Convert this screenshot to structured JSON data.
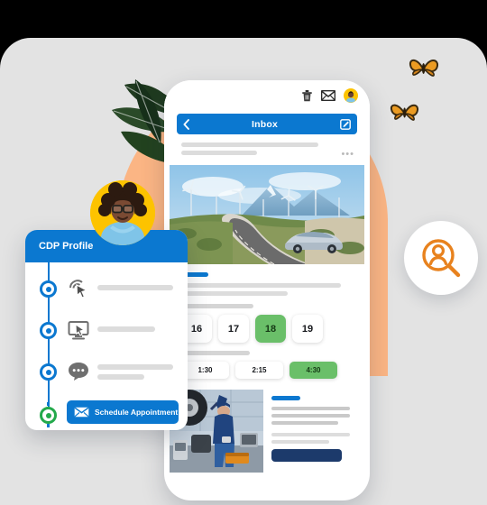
{
  "colors": {
    "brand_blue": "#0b78d0",
    "navy": "#1c3a6b",
    "green": "#6abf69",
    "green_dot": "#23a94b",
    "peach": "#fbb584",
    "yellow": "#fdc300",
    "orange": "#e8821e",
    "canvas_gray": "#e3e3e3"
  },
  "phone": {
    "top_icons": [
      "trash-icon",
      "envelope-icon",
      "avatar-icon"
    ],
    "navbar": {
      "back_icon": "chevron-left-icon",
      "title": "Inbox",
      "compose_icon": "compose-icon"
    },
    "message": {
      "overflow": "•••"
    },
    "hero_image": "highway-with-wind-turbines-and-silver-car",
    "appointment": {
      "days": [
        {
          "label": "16",
          "selected": false
        },
        {
          "label": "17",
          "selected": false
        },
        {
          "label": "18",
          "selected": true
        },
        {
          "label": "19",
          "selected": false
        }
      ],
      "times": [
        {
          "label": "1:30",
          "selected": false
        },
        {
          "label": "2:15",
          "selected": false
        },
        {
          "label": "4:30",
          "selected": true
        }
      ]
    },
    "bottom_card": {
      "thumb": "mechanic-servicing-car-in-garage"
    }
  },
  "cdp_card": {
    "title": "CDP Profile",
    "steps": [
      {
        "icon": "click-target-icon",
        "completed": true
      },
      {
        "icon": "desktop-click-icon",
        "completed": true
      },
      {
        "icon": "chat-bubble-icon",
        "completed": true
      },
      {
        "icon": "envelope-icon",
        "completed": true
      }
    ],
    "cta": {
      "icon": "envelope-icon",
      "label": "Schedule Appointment"
    }
  },
  "decorations": {
    "avatar_badge": "woman-with-glasses-portrait",
    "search_badge": "person-search-icon",
    "butterflies": [
      "butterfly-1",
      "butterfly-2"
    ],
    "leaves": "tropical-leaves"
  }
}
